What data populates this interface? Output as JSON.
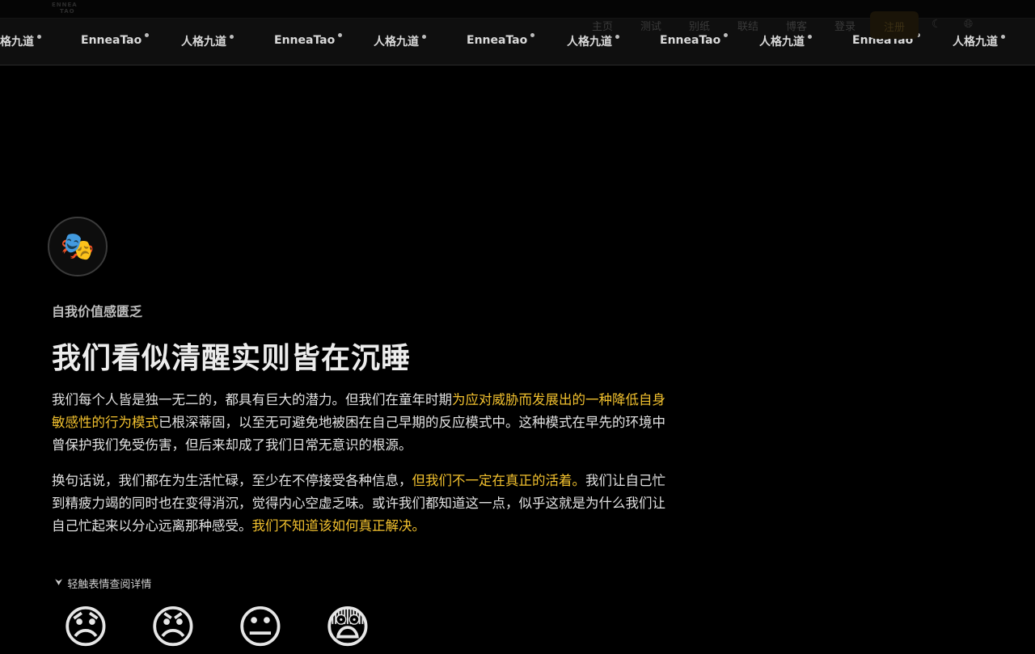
{
  "header": {
    "logo_line1": "ENNEA",
    "logo_line2": "TAO",
    "nav_items": [
      "主页",
      "测试",
      "别纸",
      "联结",
      "博客",
      "登录"
    ],
    "register_label": "注册",
    "theme_icon": "moon-icon",
    "language_icon": "globe-icon"
  },
  "ticker": {
    "items": [
      "人格九道",
      "EnneaTao",
      "人格九道",
      "EnneaTao",
      "人格九道",
      "EnneaTao",
      "人格九道",
      "EnneaTao",
      "人格九道",
      "EnneaTao",
      "人格九道"
    ]
  },
  "hero": {
    "avatar_emoji": "🎭",
    "subtitle": "自我价值感匮乏",
    "title": "我们看似清醒实则皆在沉睡",
    "para1": {
      "a": "我们每个人皆是独一无二的，都具有巨大的潜力。但我们在童年时期",
      "b": "为应对威胁而发展出的一种降低自身敏感性的行为模式",
      "c": "已根深蒂固，以至无可避免地被困在自己早期的反应模式中。这种模式在早先的环境中曾保护我们免受伤害，但后来却成了我们日常无意识的根源。"
    },
    "para2": {
      "a": "换句话说，我们都在为生活忙碌，至少在不停接受各种信息，",
      "b": "但我们不一定在真正的活着。",
      "c": "我们让自己忙到精疲力竭的同时也在变得消沉，觉得内心空虚乏味。或许我们都知道这一点，似乎这就是为什么我们让自己忙起来以分心远离那种感受。",
      "d": "我们不知道该如何真正解决。"
    },
    "hint": "轻触表情查阅详情",
    "emojis": [
      "😞",
      "😠",
      "😐",
      "😨"
    ],
    "highlight_color": "#f2c12e"
  }
}
